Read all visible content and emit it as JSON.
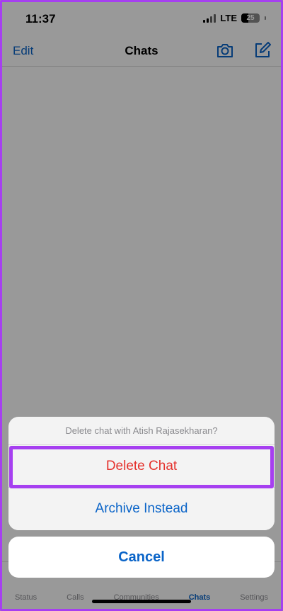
{
  "status_bar": {
    "time": "11:37",
    "network": "LTE",
    "battery": "25"
  },
  "nav": {
    "edit_label": "Edit",
    "title": "Chats",
    "camera_icon": "camera-icon",
    "compose_icon": "compose-icon"
  },
  "tabs": [
    {
      "label": "Status"
    },
    {
      "label": "Calls"
    },
    {
      "label": "Communities"
    },
    {
      "label": "Chats",
      "active": true
    },
    {
      "label": "Settings"
    }
  ],
  "action_sheet": {
    "title": "Delete chat with Atish Rajasekharan?",
    "delete_label": "Delete Chat",
    "archive_label": "Archive Instead",
    "cancel_label": "Cancel"
  },
  "colors": {
    "accent": "#0a64c8",
    "destructive": "#e5322d",
    "highlight": "#a63ff0"
  }
}
